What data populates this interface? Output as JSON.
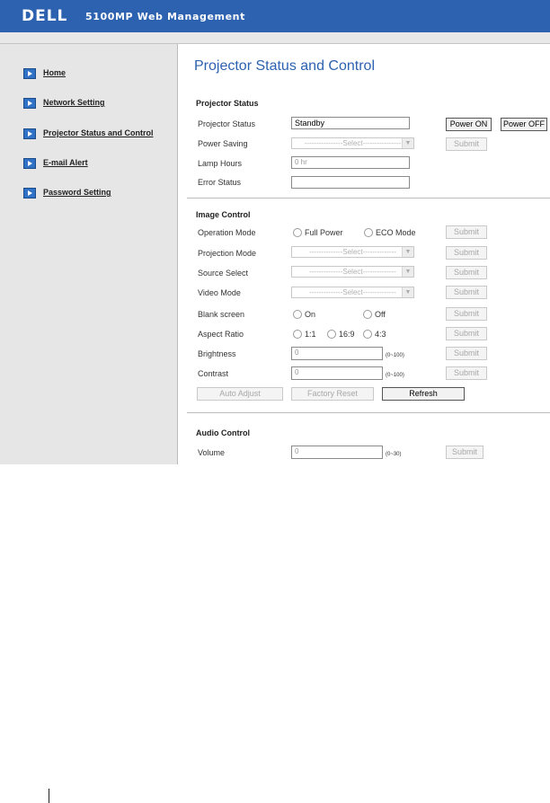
{
  "header": {
    "logo": "DELL",
    "title": "5100MP Web Management",
    "brand_color": "#2d62b0"
  },
  "sidebar": {
    "items": [
      {
        "label": "Home"
      },
      {
        "label": "Network Setting"
      },
      {
        "label": "Projector Status and Control"
      },
      {
        "label": "E-mail Alert"
      },
      {
        "label": "Password Setting"
      }
    ]
  },
  "main": {
    "title": "Projector Status and Control",
    "projector_status": {
      "heading": "Projector Status",
      "status_label": "Projector Status",
      "status_value": "Standby",
      "power_on": "Power ON",
      "power_off": "Power OFF",
      "power_saving_label": "Power Saving",
      "power_saving_select": "----------------Select----------------",
      "lamp_hours_label": "Lamp Hours",
      "lamp_hours_value": "0 hr",
      "error_status_label": "Error Status",
      "error_status_value": "",
      "submit": "Submit"
    },
    "image_control": {
      "heading": "Image Control",
      "operation_mode_label": "Operation Mode",
      "full_power": "Full Power",
      "eco_mode": "ECO Mode",
      "projection_mode_label": "Projection Mode",
      "source_select_label": "Source Select",
      "video_mode_label": "Video Mode",
      "select_text": "--------------Select--------------",
      "blank_screen_label": "Blank screen",
      "on": "On",
      "off": "Off",
      "aspect_ratio_label": "Aspect Ratio",
      "ratio_1_1": "1:1",
      "ratio_16_9": "16:9",
      "ratio_4_3": "4:3",
      "brightness_label": "Brightness",
      "brightness_value": "0",
      "brightness_range": "(0~100)",
      "contrast_label": "Contrast",
      "contrast_value": "0",
      "contrast_range": "(0~100)",
      "submit": "Submit",
      "auto_adjust": "Auto Adjust",
      "factory_reset": "Factory Reset",
      "refresh": "Refresh"
    },
    "audio_control": {
      "heading": "Audio Control",
      "volume_label": "Volume",
      "volume_value": "0",
      "volume_range": "(0~30)",
      "submit": "Submit"
    }
  }
}
